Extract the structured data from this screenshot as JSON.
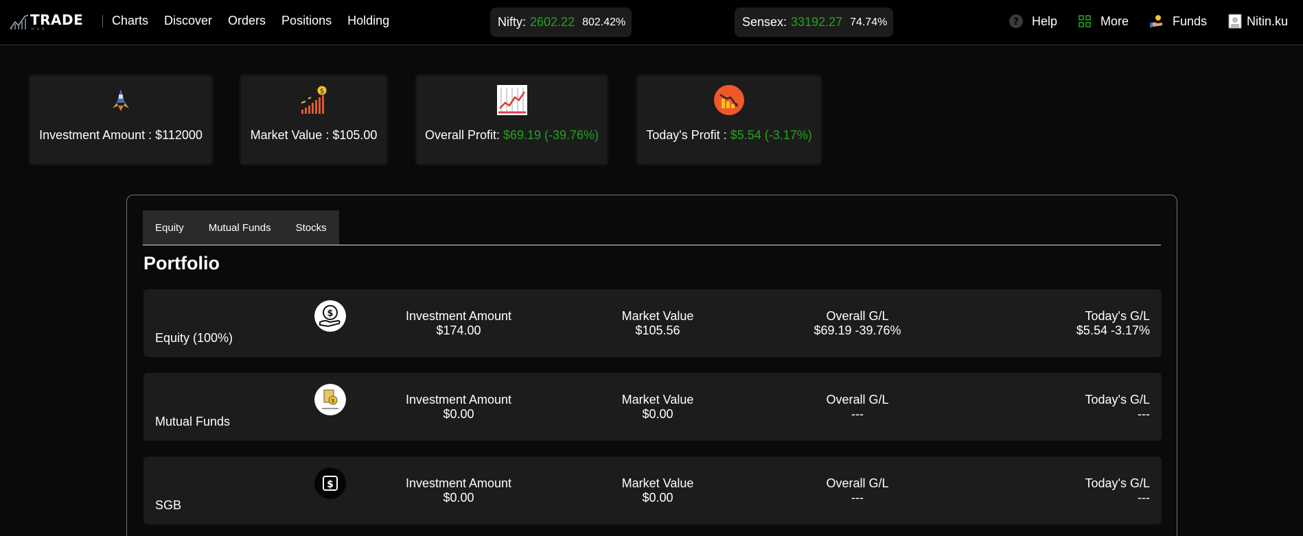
{
  "brand": {
    "name": "TRADE",
    "sub": "HUB"
  },
  "nav": [
    "Charts",
    "Discover",
    "Orders",
    "Positions",
    "Holding"
  ],
  "tickers": {
    "nifty": {
      "label": "Nifty:",
      "value": "2602.22",
      "pct": "802.42%"
    },
    "sensex": {
      "label": "Sensex:",
      "value": "33192.27",
      "pct": "74.74%"
    }
  },
  "right_nav": {
    "help": "Help",
    "more": "More",
    "funds": "Funds",
    "user": "Nitin.ku"
  },
  "summary": {
    "investment": "Investment Amount : $112000",
    "market": "Market Value : $105.00",
    "overall_label": "Overall Profit: ",
    "overall_value": "$69.19 (-39.76%)",
    "today_label": "Today's Profit : ",
    "today_value": "$5.54 (-3.17%)"
  },
  "tabs": [
    "Equity",
    "Mutual Funds",
    "Stocks"
  ],
  "portfolio": {
    "title": "Portfolio",
    "rows": [
      {
        "name": "Equity (100%)",
        "inv_label": "Investment Amount",
        "inv": "$174.00",
        "mv_label": "Market Value",
        "mv": "$105.56",
        "gl_label": "Overall G/L",
        "gl": "$69.19 -39.76%",
        "today_label": "Today's G/L",
        "today": "$5.54 -3.17%"
      },
      {
        "name": "Mutual Funds",
        "inv_label": "Investment Amount",
        "inv": "$0.00",
        "mv_label": "Market Value",
        "mv": "$0.00",
        "gl_label": "Overall G/L",
        "gl": "---",
        "today_label": "Today's G/L",
        "today": "---"
      },
      {
        "name": "SGB",
        "inv_label": "Investment Amount",
        "inv": "$0.00",
        "mv_label": "Market Value",
        "mv": "$0.00",
        "gl_label": "Overall G/L",
        "gl": "---",
        "today_label": "Today's G/L",
        "today": "---"
      }
    ]
  },
  "colors": {
    "positive": "#22a31f",
    "card": "#1c1c1c",
    "bg": "#0a0a0a"
  }
}
